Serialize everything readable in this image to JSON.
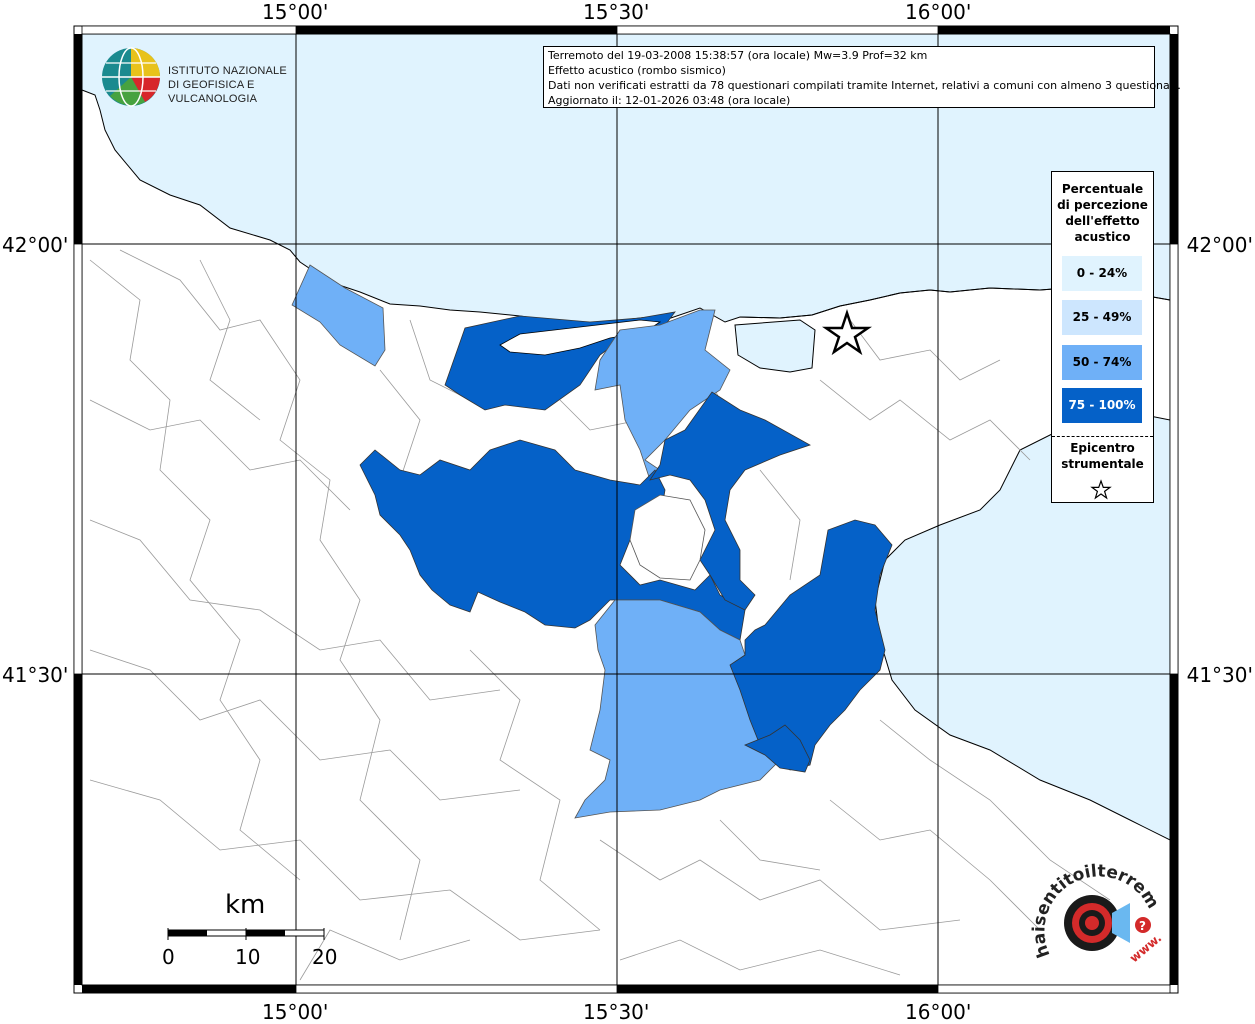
{
  "map": {
    "lat_labels": [
      "42°00'",
      "41°30'"
    ],
    "lon_labels": [
      "15°00'",
      "15°30'",
      "16°00'"
    ],
    "colors": {
      "sea": "#e0f3fe",
      "land": "#ffffff",
      "class_0_24": "#e0f3fe",
      "class_25_49": "#cde6fe",
      "class_50_74": "#6fb0f7",
      "class_75_100": "#0561c8",
      "border": "#000000",
      "municipal_lines": "#9a9a9a"
    }
  },
  "institute": {
    "line1": "ISTITUTO NAZIONALE",
    "line2": "DI GEOFISICA E VULCANOLOGIA",
    "icon": "globe-logo-icon"
  },
  "info": {
    "line1": "Terremoto del 19-03-2008 15:38:57 (ora locale) Mw=3.9 Prof=32 km",
    "line2": "Effetto acustico (rombo sismico)",
    "line3": "Dati non verificati estratti da 78 questionari compilati tramite Internet, relativi a comuni con almeno 3 questionari.",
    "line4": "Aggiornato il: 12-01-2026 03:48 (ora locale)"
  },
  "legend": {
    "title_lines": [
      "Percentuale",
      "di percezione",
      "dell'effetto",
      "acustico"
    ],
    "classes": [
      "0 - 24%",
      "25 - 49%",
      "50 - 74%",
      "75 - 100%"
    ],
    "epicenter_lines": [
      "Epicentro",
      "strumentale"
    ],
    "epicenter_icon": "star-icon"
  },
  "scale": {
    "unit": "km",
    "ticks": [
      "0",
      "10",
      "20"
    ]
  },
  "watermark": {
    "text_arc": "haisentitoilterremoto.it",
    "text_www": "www.",
    "icon": "speaker-target-icon"
  }
}
